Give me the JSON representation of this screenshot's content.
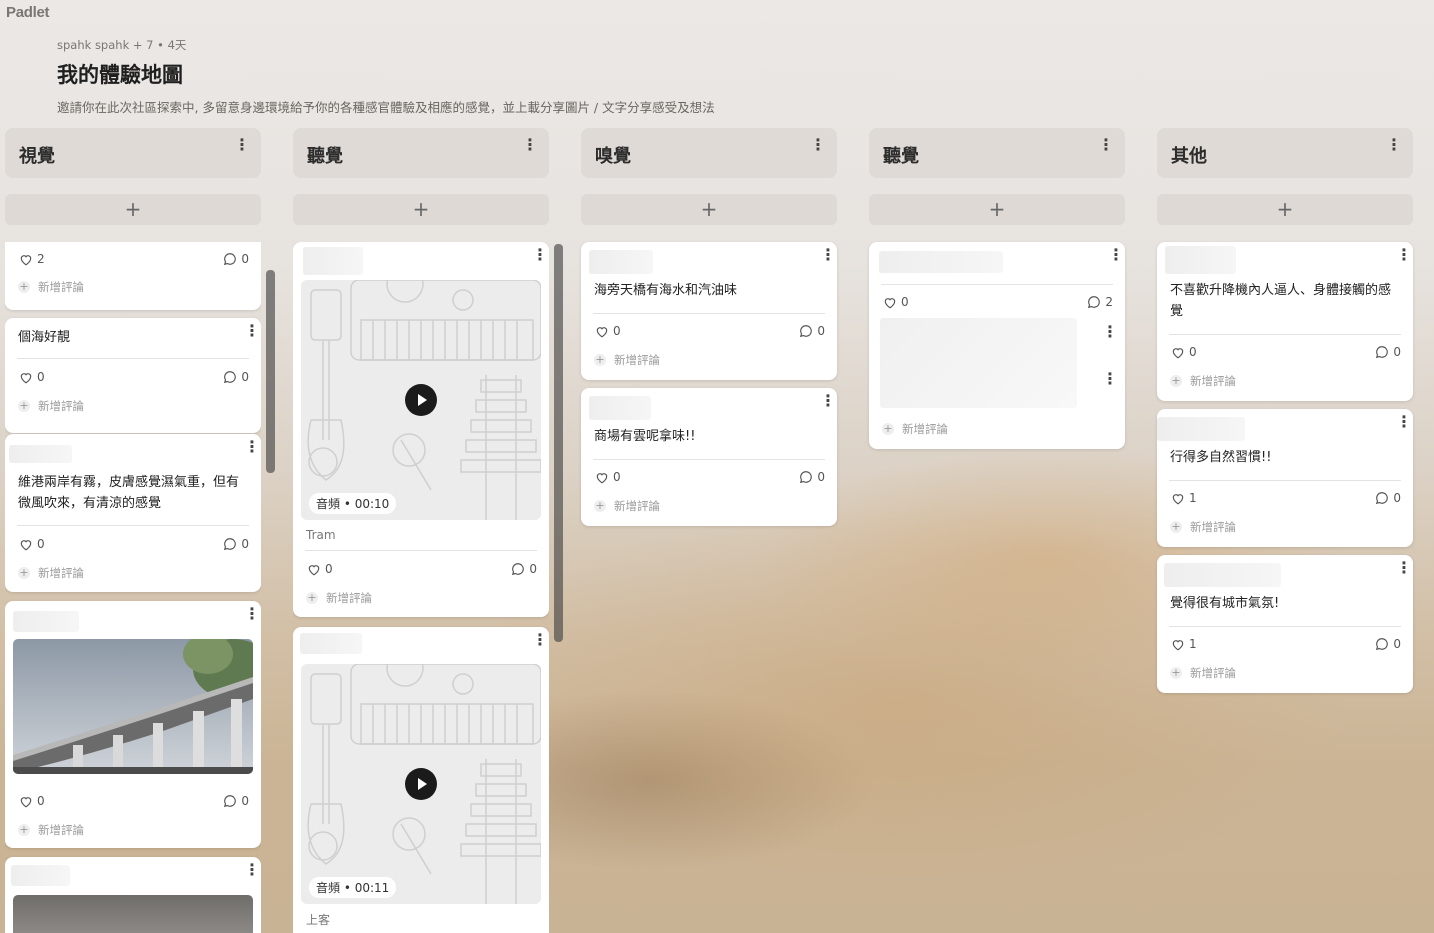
{
  "app": {
    "logo": "Padlet"
  },
  "header": {
    "meta": "spahk spahk + 7 • 4天",
    "title": "我的體驗地圖",
    "description": "邀請你在此次社區探索中, 多留意身邊環境給予你的各種感官體驗及相應的感覺，並上載分享圖片 / 文字分享感受及想法"
  },
  "labels": {
    "add_comment": "新增評論",
    "add": "+"
  },
  "columns": [
    {
      "title": "視覺"
    },
    {
      "title": "聽覺"
    },
    {
      "title": "嗅覺"
    },
    {
      "title": "聽覺"
    },
    {
      "title": "其他"
    }
  ],
  "cards": {
    "c1a": {
      "likes": "2",
      "comments": "0"
    },
    "c1b": {
      "text": "個海好靚",
      "likes": "0",
      "comments": "0"
    },
    "c1c": {
      "text": "維港兩岸有霧，皮膚感覺濕氣重，但有微風吹來，有清涼的感覺",
      "likes": "0",
      "comments": "0"
    },
    "c1d": {
      "likes": "0",
      "comments": "0"
    },
    "c2a": {
      "audio_label": "音頻",
      "duration": "00:10",
      "caption": "Tram",
      "likes": "0",
      "comments": "0"
    },
    "c2b": {
      "audio_label": "音頻",
      "duration": "00:11",
      "caption": "上客"
    },
    "c3a": {
      "text": "海旁天橋有海水和汽油味",
      "likes": "0",
      "comments": "0"
    },
    "c3b": {
      "text": "商場有雲呢拿味!!",
      "likes": "0",
      "comments": "0"
    },
    "c4a": {
      "likes": "0",
      "comments": "2"
    },
    "c5a": {
      "text": "不喜歡升降機內人逼人、身體接觸的感覺",
      "likes": "0",
      "comments": "0"
    },
    "c5b": {
      "text": "行得多自然習慣!!",
      "likes": "1",
      "comments": "0"
    },
    "c5c": {
      "text": "覺得很有城市氣氛!",
      "likes": "1",
      "comments": "0"
    }
  },
  "icons": [
    "kebab-icon",
    "plus-icon",
    "heart-icon",
    "comment-icon",
    "play-icon"
  ]
}
